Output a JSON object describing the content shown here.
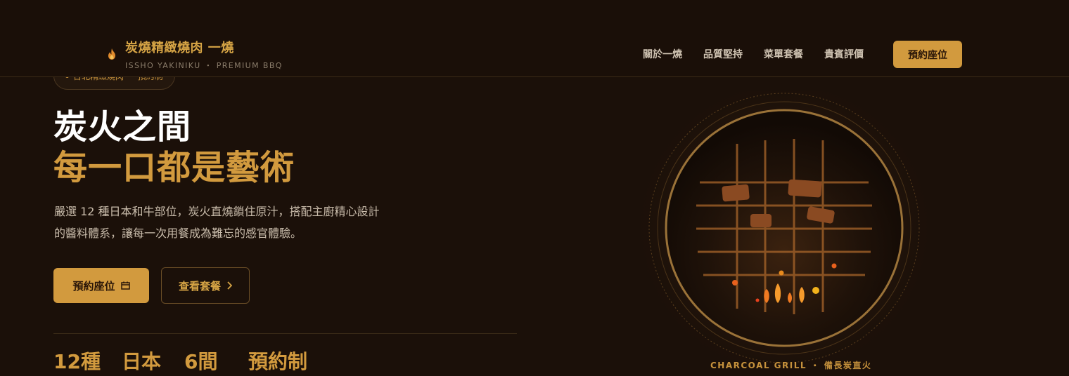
{
  "nav": {
    "brand_name": "炭燒精緻燒肉 一燒",
    "brand_sub": "ISSHO YAKINIKU ・ PREMIUM BBQ",
    "menu": [
      "關於一燒",
      "品質堅持",
      "菜單套餐",
      "貴賓評價"
    ],
    "cta": "預約座位"
  },
  "hero": {
    "badge": "台北精緻燒肉 ・ 預約制",
    "title_line1": "炭火之間",
    "title_line2": "每一口都是藝術",
    "description": "嚴選 12 種日本和牛部位，炭火直燒鎖住原汁，搭配主廚精心設計的醬料體系，讓每一次用餐成為難忘的感官體驗。",
    "primary_button": "預約座位",
    "secondary_button": "查看套餐",
    "stats": [
      "12種",
      "日本",
      "6間",
      "預約制"
    ]
  },
  "grill": {
    "caption": "CHARCOAL GRILL ・ 備長炭直火"
  },
  "colors": {
    "background": "#1b1009",
    "accent": "#d29a3e",
    "text": "#d8cbb8"
  }
}
